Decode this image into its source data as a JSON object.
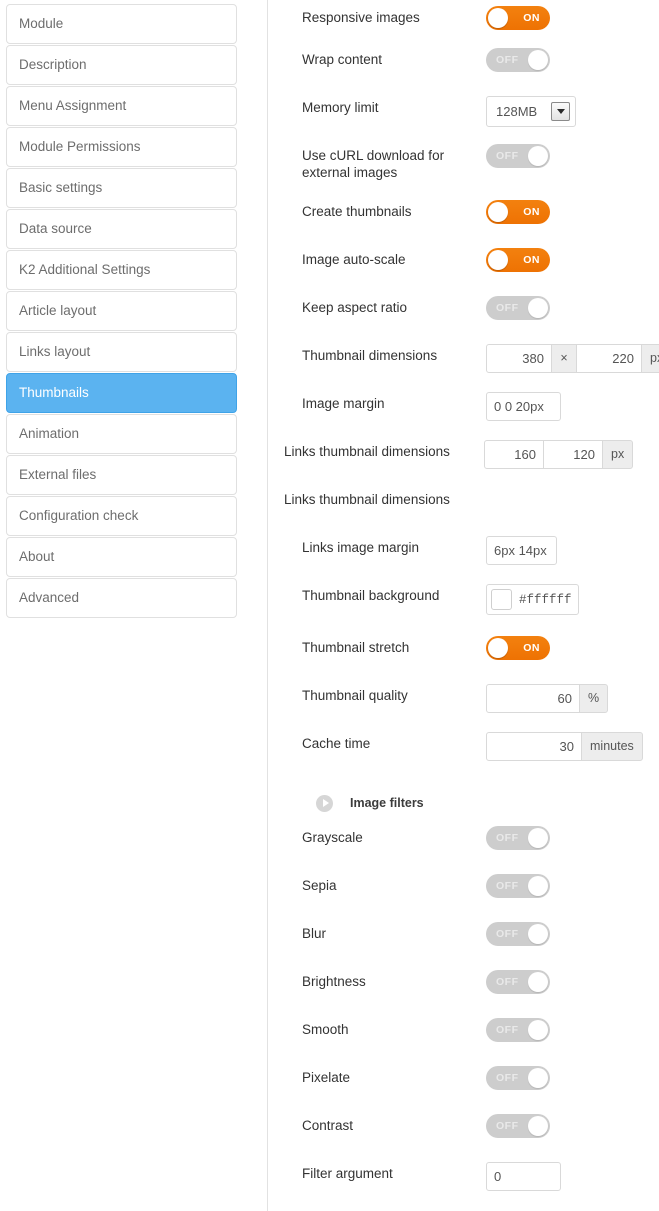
{
  "sidebar": {
    "items": [
      {
        "label": "Module",
        "active": false
      },
      {
        "label": "Description",
        "active": false
      },
      {
        "label": "Menu Assignment",
        "active": false
      },
      {
        "label": "Module Permissions",
        "active": false
      },
      {
        "label": "Basic settings",
        "active": false
      },
      {
        "label": "Data source",
        "active": false
      },
      {
        "label": "K2 Additional Settings",
        "active": false
      },
      {
        "label": "Article layout",
        "active": false
      },
      {
        "label": "Links layout",
        "active": false
      },
      {
        "label": "Thumbnails",
        "active": true
      },
      {
        "label": "Animation",
        "active": false
      },
      {
        "label": "External files",
        "active": false
      },
      {
        "label": "Configuration check",
        "active": false
      },
      {
        "label": "About",
        "active": false
      },
      {
        "label": "Advanced",
        "active": false
      }
    ]
  },
  "settings": {
    "responsive_images": {
      "label": "Responsive images",
      "state": "ON"
    },
    "wrap_content": {
      "label": "Wrap content",
      "state": "OFF"
    },
    "memory_limit": {
      "label": "Memory limit",
      "value": "128MB"
    },
    "use_curl": {
      "label": "Use cURL download for external images",
      "state": "OFF"
    },
    "create_thumbnails": {
      "label": "Create thumbnails",
      "state": "ON"
    },
    "image_auto_scale": {
      "label": "Image auto-scale",
      "state": "ON"
    },
    "keep_aspect_ratio": {
      "label": "Keep aspect ratio",
      "state": "OFF"
    },
    "thumbnail_dimensions": {
      "label": "Thumbnail dimensions",
      "width": "380",
      "separator": "×",
      "height": "220",
      "unit": "px"
    },
    "image_margin": {
      "label": "Image margin",
      "value": "0 0 20px"
    },
    "links_thumbnail_dimensions": {
      "label": "Links thumbnail dimensions",
      "width": "160",
      "height": "120",
      "unit": "px"
    },
    "links_thumbnail_dimensions_2": {
      "label": "Links thumbnail dimensions"
    },
    "links_image_margin": {
      "label": "Links image margin",
      "value": "6px 14px"
    },
    "thumbnail_background": {
      "label": "Thumbnail background",
      "value": "#ffffff",
      "swatch_color": "#ffffff"
    },
    "thumbnail_stretch": {
      "label": "Thumbnail stretch",
      "state": "ON"
    },
    "thumbnail_quality": {
      "label": "Thumbnail quality",
      "value": "60",
      "unit": "%"
    },
    "cache_time": {
      "label": "Cache time",
      "value": "30",
      "unit": "minutes"
    },
    "image_filters_section": {
      "label": "Image filters"
    },
    "grayscale": {
      "label": "Grayscale",
      "state": "OFF"
    },
    "sepia": {
      "label": "Sepia",
      "state": "OFF"
    },
    "blur": {
      "label": "Blur",
      "state": "OFF"
    },
    "brightness": {
      "label": "Brightness",
      "state": "OFF"
    },
    "smooth": {
      "label": "Smooth",
      "state": "OFF"
    },
    "pixelate": {
      "label": "Pixelate",
      "state": "OFF"
    },
    "contrast": {
      "label": "Contrast",
      "state": "OFF"
    },
    "filter_argument": {
      "label": "Filter argument",
      "value": "0"
    }
  },
  "colors": {
    "accent_on": "#ee7203",
    "toggle_off": "#cdcdcd",
    "active_nav": "#5bb3f0"
  }
}
